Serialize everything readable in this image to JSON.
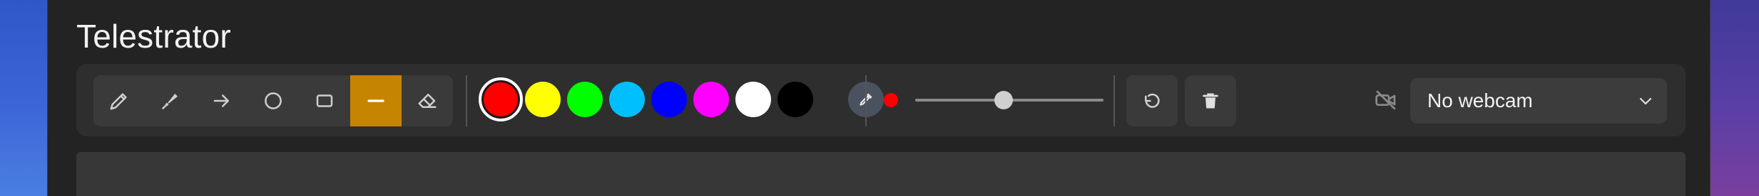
{
  "app": {
    "title": "Telestrator"
  },
  "tools": [
    {
      "name": "pen-icon",
      "label": "Pen",
      "active": false
    },
    {
      "name": "highlighter-icon",
      "label": "Highlighter",
      "active": false
    },
    {
      "name": "arrow-icon",
      "label": "Arrow",
      "active": false
    },
    {
      "name": "circle-icon",
      "label": "Circle",
      "active": false
    },
    {
      "name": "rectangle-icon",
      "label": "Rectangle",
      "active": false
    },
    {
      "name": "line-icon",
      "label": "Line",
      "active": true
    },
    {
      "name": "eraser-icon",
      "label": "Eraser",
      "active": false
    }
  ],
  "colors": {
    "accent": "#c68500",
    "swatches": [
      "#ff0000",
      "#ffff00",
      "#00ff00",
      "#00bfff",
      "#0000ff",
      "#ff00ff",
      "#ffffff",
      "#000000"
    ],
    "selected": "#ff0000"
  },
  "brush": {
    "size_fraction": 0.47,
    "color": "#ff0000"
  },
  "actions": [
    {
      "name": "undo-icon"
    },
    {
      "name": "trash-icon"
    }
  ],
  "webcam": {
    "icon": "video-off-icon",
    "selected": "No webcam"
  }
}
